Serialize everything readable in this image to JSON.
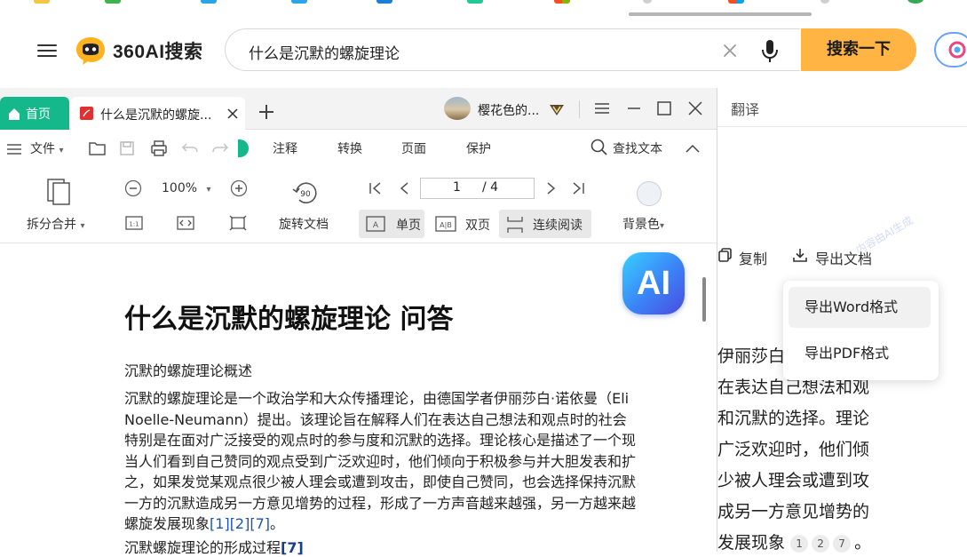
{
  "header": {
    "logo_text": "360AI搜索",
    "search_value": "什么是沉默的螺旋理论",
    "search_button": "搜索一下"
  },
  "viewer": {
    "tabs": [
      {
        "label": "首页"
      },
      {
        "label": "什么是沉默的螺旋..."
      }
    ],
    "user_name": "樱花色的...",
    "menubar": {
      "file": "文件",
      "items": [
        "注释",
        "转换",
        "页面",
        "保护"
      ],
      "find": "查找文本"
    },
    "toolbar": {
      "split_merge": "拆分合并",
      "zoom": "100%",
      "rotate": "旋转文档",
      "page_current": "1",
      "page_total": "/ 4",
      "single": "单页",
      "double": "双页",
      "continuous": "连续阅读",
      "background": "背景色"
    },
    "ai_badge": "AI"
  },
  "document": {
    "title": "什么是沉默的螺旋理论 问答",
    "subtitle": "沉默的螺旋理论概述",
    "lines": [
      "沉默的螺旋理论是一个政治学和大众传播理论，由德国学者伊丽莎白·诺依曼（Eli",
      "Noelle-Neumann）提出。该理论旨在解释人们在表达自己想法和观点时的社会",
      "特别是在面对广泛接受的观点时的参与度和沉默的选择。理论核心是描述了一个现",
      "当人们看到自己赞同的观点受到广泛欢迎时，他们倾向于积极参与并大胆发表和扩",
      "之，如果发觉某观点很少被人理会或遭到攻击，即使自己赞同，也会选择保持沉默",
      "一方的沉默造成另一方意见增势的过程，形成了一方声音越来越强，另一方越来越"
    ],
    "last_line_text": "螺旋发展现象",
    "refs": [
      "[1]",
      "[2]",
      "[7]"
    ],
    "last_line_end": "。",
    "section2": "沉默螺旋理论的形成过程",
    "section2_ref": "[7]"
  },
  "right_pane": {
    "tab": "翻译",
    "copy": "复制",
    "export": "导出文档",
    "watermark": "内容由AI生成",
    "menu": [
      "导出Word格式",
      "导出PDF格式"
    ],
    "lines": [
      "伊丽莎白",
      "在表达自己想法和观",
      "和沉默的选择。理论",
      "广泛欢迎时，他们倾",
      "少被人理会或遭到攻",
      "成另一方意见增势的"
    ],
    "last_line": "发展现象",
    "refs": [
      "1",
      "2",
      "7"
    ],
    "last_end": "。"
  }
}
